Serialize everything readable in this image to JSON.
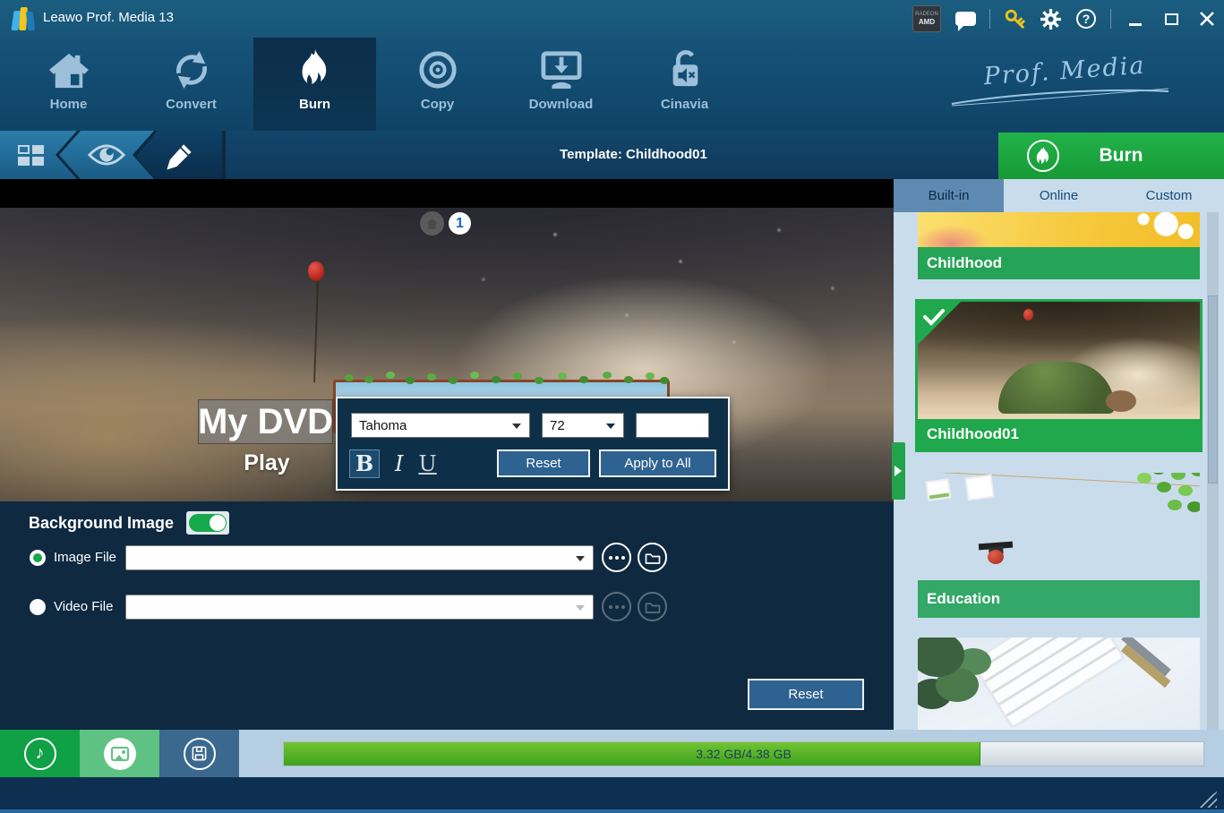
{
  "titlebar": {
    "title": "Leawo Prof. Media 13",
    "amd_badge": {
      "line1": "RADEON",
      "line2": "AMD"
    },
    "icons": [
      "feedback-chat",
      "register-key",
      "settings-gear",
      "help"
    ],
    "window_controls": [
      "minimize",
      "maximize",
      "close"
    ]
  },
  "nav": {
    "brand": "Prof. Media",
    "items": [
      {
        "label": "Home",
        "icon": "home",
        "active": false
      },
      {
        "label": "Convert",
        "icon": "convert-arrows",
        "active": false
      },
      {
        "label": "Burn",
        "icon": "flame",
        "active": true
      },
      {
        "label": "Copy",
        "icon": "disc",
        "active": false
      },
      {
        "label": "Download",
        "icon": "download-monitor",
        "active": false
      },
      {
        "label": "Cinavia",
        "icon": "padlock-mute",
        "active": false
      }
    ]
  },
  "toolbar": {
    "icons": [
      "template-gallery-grid",
      "preview-eye",
      "edit-pencil"
    ],
    "active_tool": "edit-pencil",
    "template_label": "Template: Childhood01",
    "burn_button_label": "Burn"
  },
  "preview": {
    "page_number": "1",
    "dvd_title": "My DVD",
    "play_label": "Play"
  },
  "text_editor": {
    "font_family_value": "Tahoma",
    "font_size_value": "72",
    "bold_label": "B",
    "italic_label": "I",
    "underline_label": "U",
    "bold_active": true,
    "reset_label": "Reset",
    "apply_all_label": "Apply to All"
  },
  "background_panel": {
    "heading": "Background Image",
    "toggle_on": true,
    "rows": [
      {
        "label": "Image File",
        "selected": true,
        "value": "",
        "buttons": [
          "history-ellipsis",
          "browse-folder"
        ],
        "enabled": true
      },
      {
        "label": "Video File",
        "selected": false,
        "value": "",
        "buttons": [
          "history-ellipsis",
          "browse-folder"
        ],
        "enabled": false
      }
    ],
    "reset_label": "Reset"
  },
  "status": {
    "progress_text": "3.32 GB/4.38 GB",
    "progress_percent": 75.8,
    "used_gb": 3.32,
    "total_gb": 4.38
  },
  "bottom_toolbar": {
    "buttons": [
      "audio-menu",
      "image-menu",
      "save-template"
    ],
    "active": "image-menu"
  },
  "right_panel": {
    "tabs": [
      {
        "label": "Built-in",
        "active": true
      },
      {
        "label": "Online",
        "active": false
      },
      {
        "label": "Custom",
        "active": false
      }
    ],
    "templates": [
      {
        "name": "Childhood",
        "selected": false
      },
      {
        "name": "Childhood01",
        "selected": true
      },
      {
        "name": "Education",
        "selected": false
      },
      {
        "name": "",
        "selected": false
      }
    ]
  },
  "colors": {
    "accent_green": "#1fa84c",
    "titlebar_blue": "#175578",
    "panel_navy": "#0e2940",
    "steel_blue": "#2e6290",
    "progress_green": "#4fae1f",
    "panel_light_blue": "#c9dcec"
  }
}
